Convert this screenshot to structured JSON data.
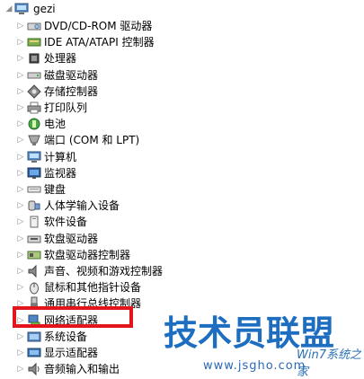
{
  "tree": {
    "root": {
      "label": "gezi",
      "icon": "computer-icon",
      "arrow": "◢"
    },
    "items": [
      {
        "label": "DVD/CD-ROM 驱动器",
        "icon": "dvd-drive-icon"
      },
      {
        "label": "IDE ATA/ATAPI 控制器",
        "icon": "ide-controller-icon"
      },
      {
        "label": "处理器",
        "icon": "processor-icon"
      },
      {
        "label": "磁盘驱动器",
        "icon": "disk-drive-icon"
      },
      {
        "label": "存储控制器",
        "icon": "storage-controller-icon"
      },
      {
        "label": "打印队列",
        "icon": "printer-icon"
      },
      {
        "label": "电池",
        "icon": "battery-icon"
      },
      {
        "label": "端口 (COM 和 LPT)",
        "icon": "port-icon"
      },
      {
        "label": "计算机",
        "icon": "computer-icon"
      },
      {
        "label": "监视器",
        "icon": "monitor-icon"
      },
      {
        "label": "键盘",
        "icon": "keyboard-icon"
      },
      {
        "label": "人体学输入设备",
        "icon": "hid-icon"
      },
      {
        "label": "软件设备",
        "icon": "software-device-icon"
      },
      {
        "label": "软盘驱动器",
        "icon": "floppy-drive-icon"
      },
      {
        "label": "软盘驱动器控制器",
        "icon": "floppy-controller-icon"
      },
      {
        "label": "声音、视频和游戏控制器",
        "icon": "speaker-icon"
      },
      {
        "label": "鼠标和其他指针设备",
        "icon": "mouse-icon"
      },
      {
        "label": "通用串行总线控制器",
        "icon": "usb-icon"
      },
      {
        "label": "网络适配器",
        "icon": "network-adapter-icon"
      },
      {
        "label": "系统设备",
        "icon": "system-device-icon"
      },
      {
        "label": "显示适配器",
        "icon": "display-adapter-icon"
      },
      {
        "label": "音频输入和输出",
        "icon": "audio-icon"
      }
    ],
    "collapsed_arrow": "▷"
  },
  "watermark": {
    "title": "技术员联盟",
    "subtitle": "Win7系统之家",
    "url": "www.jsgho.com"
  },
  "colors": {
    "highlight": "#e3141c",
    "watermark": "#1d6ec0"
  }
}
